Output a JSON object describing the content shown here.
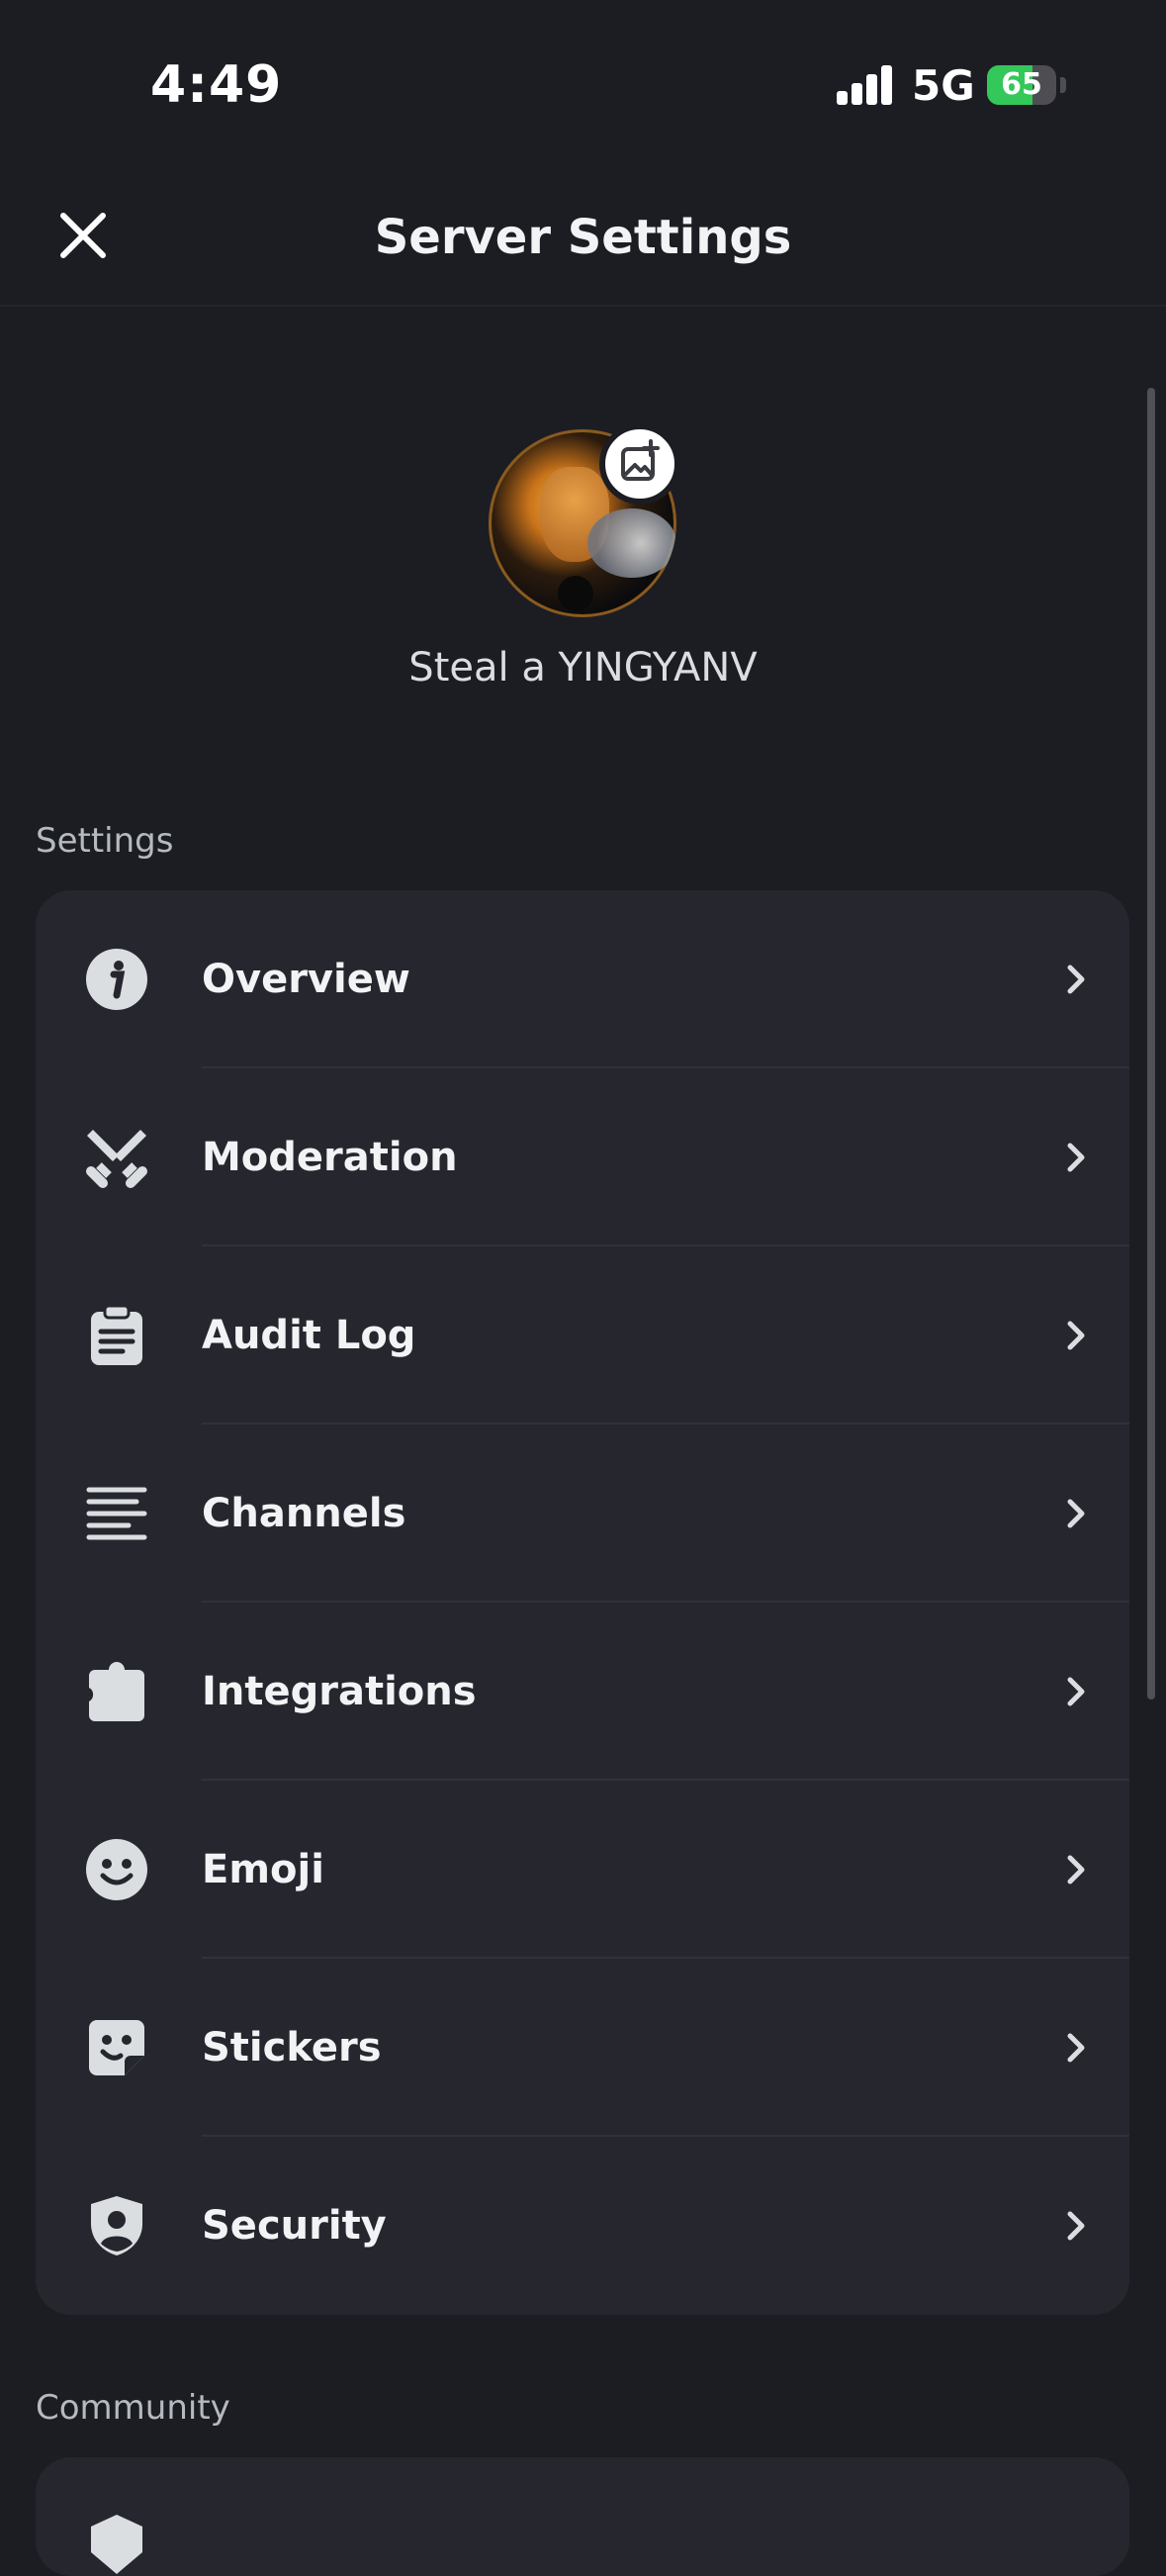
{
  "status_bar": {
    "time": "4:49",
    "network": "5G",
    "battery_percent": 65,
    "battery_label": "65"
  },
  "header": {
    "title": "Server Settings",
    "close_icon": "close-icon"
  },
  "server": {
    "name": "Steal a YINGYANV",
    "edit_icon": "image-add-icon"
  },
  "sections": {
    "settings_label": "Settings",
    "community_label": "Community"
  },
  "settings_items": [
    {
      "label": "Overview",
      "icon": "info-icon"
    },
    {
      "label": "Moderation",
      "icon": "crossed-swords-icon"
    },
    {
      "label": "Audit Log",
      "icon": "clipboard-icon"
    },
    {
      "label": "Channels",
      "icon": "list-icon"
    },
    {
      "label": "Integrations",
      "icon": "puzzle-icon"
    },
    {
      "label": "Emoji",
      "icon": "smiley-icon"
    },
    {
      "label": "Stickers",
      "icon": "sticker-icon"
    },
    {
      "label": "Security",
      "icon": "shield-user-icon"
    }
  ],
  "colors": {
    "background": "#1c1d22",
    "card": "#26272e",
    "text": "#f2f3f5",
    "muted": "#b5bac1",
    "battery": "#34c759"
  }
}
